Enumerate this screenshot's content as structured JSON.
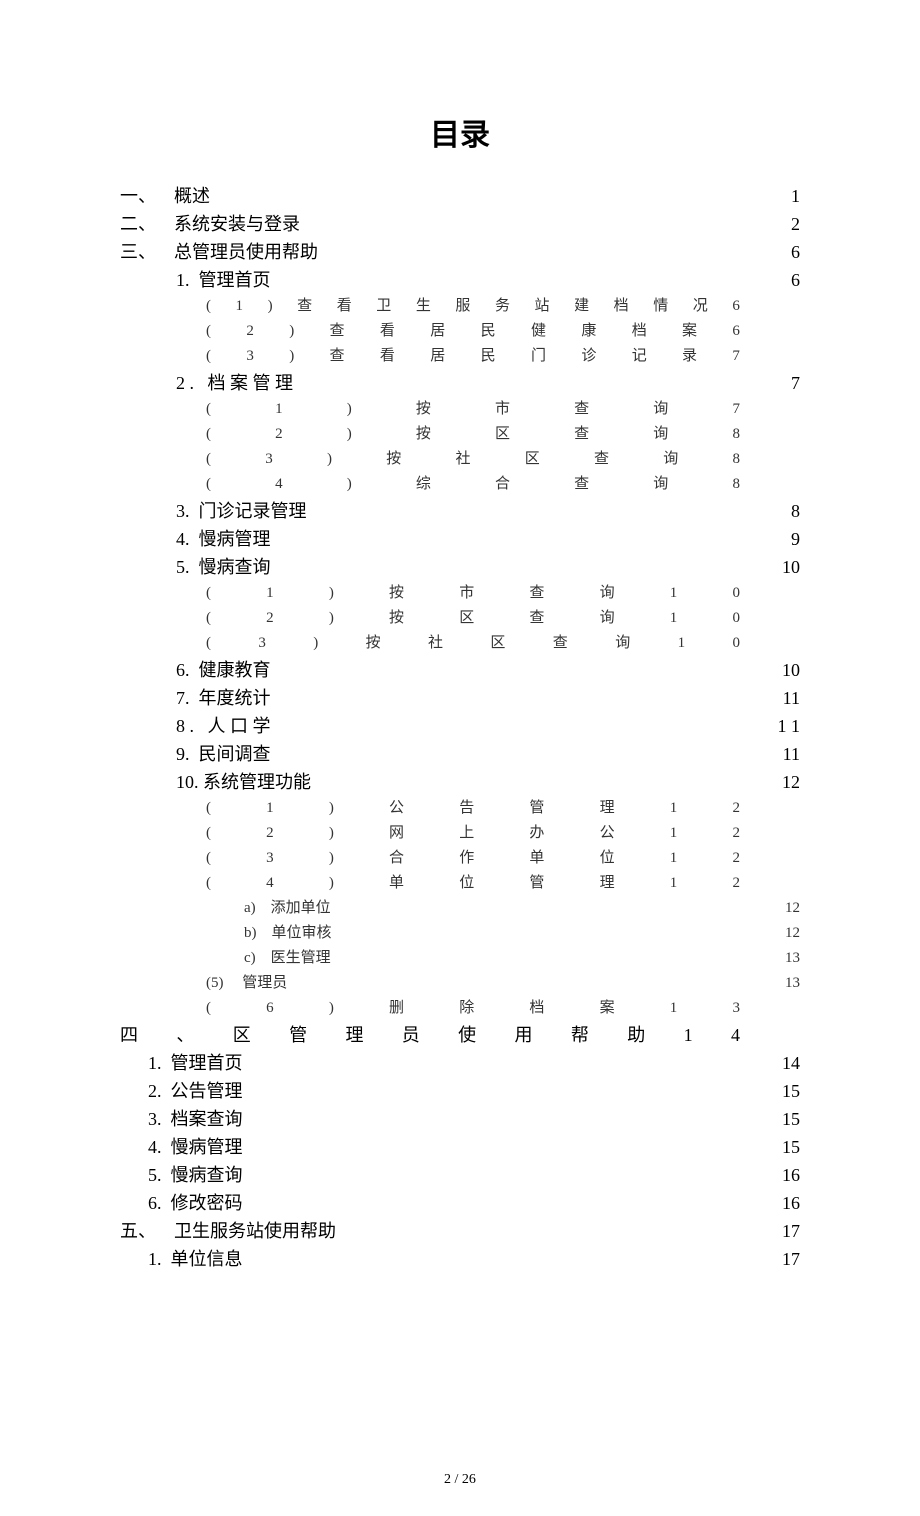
{
  "title": "目录",
  "footer": "2 / 26",
  "toc": [
    {
      "level": "lvl0",
      "text": "一、    概述",
      "page": "1"
    },
    {
      "level": "lvl0",
      "text": "二、    系统安装与登录",
      "page": "2"
    },
    {
      "level": "lvl0",
      "text": "三、    总管理员使用帮助",
      "page": "6"
    },
    {
      "level": "lvl1",
      "text": "1.  管理首页",
      "page": "6"
    },
    {
      "level": "lvl2",
      "chars": [
        "(",
        "1",
        ")",
        "查",
        "看",
        "卫",
        "生",
        "服",
        "务",
        "站",
        "建",
        "档",
        "情",
        "况",
        "6"
      ],
      "page": ""
    },
    {
      "level": "lvl2",
      "chars": [
        "(",
        "2",
        ")",
        "查",
        "看",
        "居",
        "民",
        "健",
        "康",
        "档",
        "案",
        "6"
      ],
      "page": ""
    },
    {
      "level": "lvl2",
      "chars": [
        "(",
        "3",
        ")",
        "查",
        "看",
        "居",
        "民",
        "门",
        "诊",
        "记",
        "录",
        "7"
      ],
      "page": ""
    },
    {
      "level": "lvl1",
      "text": "2 .   档 案 管 理",
      "page": "7"
    },
    {
      "level": "lvl2",
      "chars": [
        "(",
        "1",
        ")",
        "按",
        "市",
        "查",
        "询",
        "7"
      ],
      "page": ""
    },
    {
      "level": "lvl2",
      "chars": [
        "(",
        "2",
        ")",
        "按",
        "区",
        "查",
        "询",
        "8"
      ],
      "page": ""
    },
    {
      "level": "lvl2",
      "chars": [
        "(",
        "3",
        ")",
        "按",
        "社",
        "区",
        "查",
        "询",
        "8"
      ],
      "page": ""
    },
    {
      "level": "lvl2",
      "chars": [
        "(",
        "4",
        ")",
        "综",
        "合",
        "查",
        "询",
        "8"
      ],
      "page": ""
    },
    {
      "level": "lvl1",
      "text": "3.  门诊记录管理",
      "page": "8"
    },
    {
      "level": "lvl1",
      "text": "4.  慢病管理",
      "page": "9"
    },
    {
      "level": "lvl1",
      "text": "5.  慢病查询",
      "page": "10"
    },
    {
      "level": "lvl2",
      "chars": [
        "(",
        "1",
        ")",
        "按",
        "市",
        "查",
        "询",
        "1",
        "0"
      ],
      "page": ""
    },
    {
      "level": "lvl2",
      "chars": [
        "(",
        "2",
        ")",
        "按",
        "区",
        "查",
        "询",
        "1",
        "0"
      ],
      "page": ""
    },
    {
      "level": "lvl2",
      "chars": [
        "(",
        "3",
        ")",
        "按",
        "社",
        "区",
        "查",
        "询",
        "1",
        "0"
      ],
      "page": ""
    },
    {
      "level": "lvl1",
      "text": "6.  健康教育",
      "page": "10"
    },
    {
      "level": "lvl1",
      "text": "7.  年度统计",
      "page": "11"
    },
    {
      "level": "lvl1",
      "text": "8 .   人 口 学",
      "page": "1 1"
    },
    {
      "level": "lvl1",
      "text": "9.  民间调查",
      "page": "11"
    },
    {
      "level": "lvl1",
      "text": "10. 系统管理功能",
      "page": "12"
    },
    {
      "level": "lvl2",
      "chars": [
        "(",
        "1",
        ")",
        "公",
        "告",
        "管",
        "理",
        "1",
        "2"
      ],
      "page": ""
    },
    {
      "level": "lvl2",
      "chars": [
        "(",
        "2",
        ")",
        "网",
        "上",
        "办",
        "公",
        "1",
        "2"
      ],
      "page": ""
    },
    {
      "level": "lvl2",
      "chars": [
        "(",
        "3",
        ")",
        "合",
        "作",
        "单",
        "位",
        "1",
        "2"
      ],
      "page": ""
    },
    {
      "level": "lvl2",
      "chars": [
        "(",
        "4",
        ")",
        "单",
        "位",
        "管",
        "理",
        "1",
        "2"
      ],
      "page": ""
    },
    {
      "level": "lvl3",
      "text": "a)    添加单位",
      "page": "12"
    },
    {
      "level": "lvl3",
      "text": "b)    单位审核",
      "page": "12"
    },
    {
      "level": "lvl3",
      "text": "c)    医生管理",
      "page": "13"
    },
    {
      "level": "lvl2",
      "text": "(5)     管理员",
      "page": "13"
    },
    {
      "level": "lvl2",
      "chars": [
        "(",
        "6",
        ")",
        "删",
        "除",
        "档",
        "案",
        "1",
        "3"
      ],
      "page": ""
    },
    {
      "level": "lvl0",
      "chars": [
        "四",
        "、",
        "区",
        "管",
        "理",
        "员",
        "使",
        "用",
        "帮",
        "助",
        "1",
        "4"
      ],
      "page": ""
    },
    {
      "level": "lvl1b",
      "text": "1.  管理首页",
      "page": "14"
    },
    {
      "level": "lvl1b",
      "text": "2.  公告管理",
      "page": "15"
    },
    {
      "level": "lvl1b",
      "text": "3.  档案查询",
      "page": "15"
    },
    {
      "level": "lvl1b",
      "text": "4.  慢病管理",
      "page": "15"
    },
    {
      "level": "lvl1b",
      "text": "5.  慢病查询",
      "page": "16"
    },
    {
      "level": "lvl1b",
      "text": "6.  修改密码",
      "page": "16"
    },
    {
      "level": "lvl0",
      "text": "五、    卫生服务站使用帮助",
      "page": "17"
    },
    {
      "level": "lvl1b",
      "text": "1.  单位信息",
      "page": "17"
    }
  ]
}
